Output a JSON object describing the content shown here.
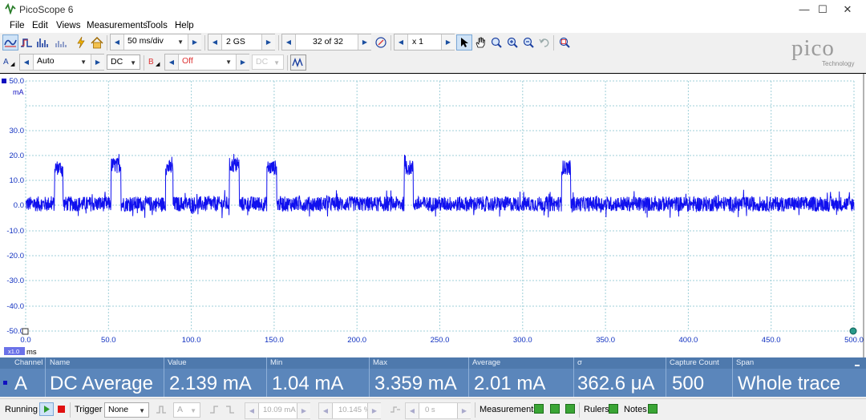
{
  "window": {
    "title": "PicoScope 6",
    "minimize": "—",
    "maximize": "☐",
    "close": "✕"
  },
  "menu": [
    "File",
    "Edit",
    "Views",
    "Measurements",
    "Tools",
    "Help"
  ],
  "toolbar": {
    "timebase": "50 ms/div",
    "samples": "2 GS",
    "buffer": "32 of 32",
    "zoom": "x 1"
  },
  "channels": {
    "a": {
      "label": "A",
      "range": "Auto",
      "coupling": "DC"
    },
    "b": {
      "label": "B",
      "range": "Off",
      "coupling": "DC"
    }
  },
  "logo": {
    "name": "pico",
    "sub": "Technology"
  },
  "scope": {
    "unit": "mA",
    "x_unit": "ms",
    "x_scale_badge": "x1.0",
    "y_ticks": [
      "50.0",
      "30.0",
      "20.0",
      "10.0",
      "0.0",
      "-10.0",
      "-20.0",
      "-30.0",
      "-40.0",
      "-50.0"
    ],
    "x_ticks": [
      "0.0",
      "50.0",
      "100.0",
      "150.0",
      "200.0",
      "250.0",
      "300.0",
      "350.0",
      "400.0",
      "450.0",
      "500.0"
    ],
    "trace_color": "#1010ee"
  },
  "chart_data": {
    "type": "line",
    "xlabel": "ms",
    "ylabel": "mA",
    "xlim": [
      0,
      500
    ],
    "ylim": [
      -50,
      50
    ],
    "grid": true,
    "baseline": 0.5,
    "pulses": [
      {
        "start": 17.5,
        "end": 22.5,
        "level": 15
      },
      {
        "start": 51.5,
        "end": 57.5,
        "level": 16
      },
      {
        "start": 84.5,
        "end": 89.0,
        "level": 15
      },
      {
        "start": 123.0,
        "end": 129.0,
        "level": 16
      },
      {
        "start": 145.5,
        "end": 151.5,
        "level": 15
      },
      {
        "start": 228.5,
        "end": 234.0,
        "level": 15
      },
      {
        "start": 323.5,
        "end": 329.0,
        "level": 15
      }
    ],
    "noise_pp_mA": 6
  },
  "measurements": {
    "headers": [
      "Channel",
      "Name",
      "Value",
      "Min",
      "Max",
      "Average",
      "σ",
      "Capture Count",
      "Span"
    ],
    "row": [
      "A",
      "DC Average",
      "2.139 mA",
      "1.04 mA",
      "3.359 mA",
      "2.01 mA",
      "362.6 μA",
      "500",
      "Whole trace"
    ]
  },
  "status": {
    "running": "Running",
    "trigger_label": "Trigger",
    "trigger_mode": "None",
    "trigger_channel": "A",
    "trigger_level": "10.09 mA",
    "trigger_pos": "10.145 %",
    "trigger_delay": "0 s",
    "measurements": "Measurements",
    "rulers": "Rulers",
    "notes": "Notes"
  }
}
